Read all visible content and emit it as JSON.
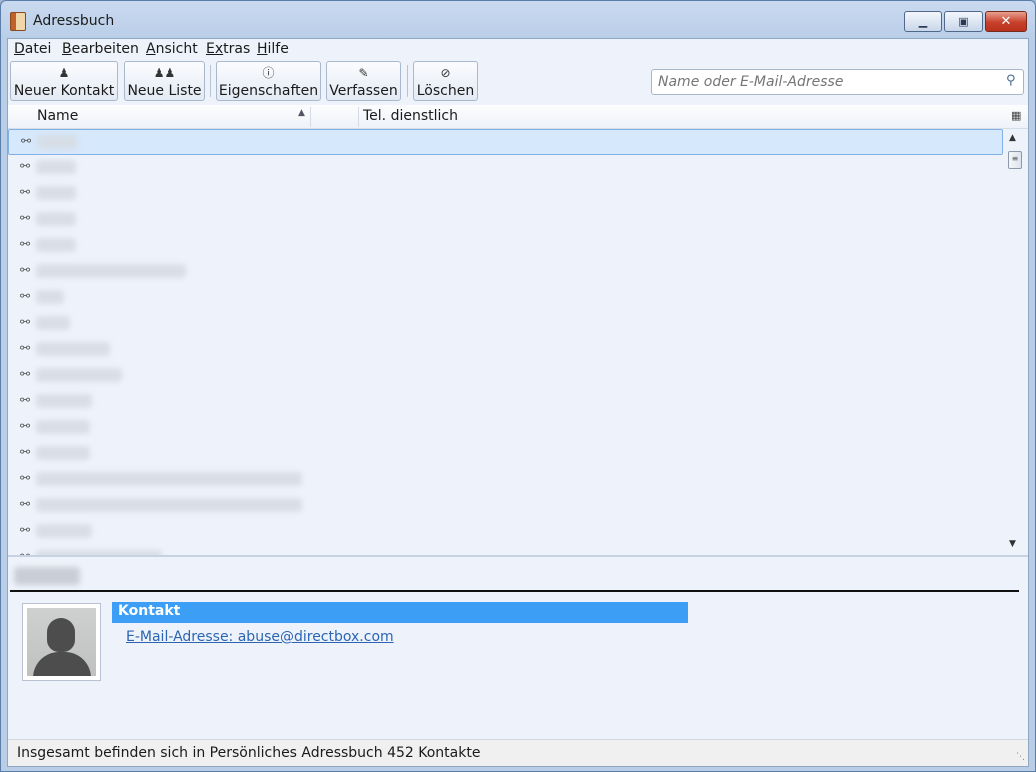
{
  "window": {
    "title": "Adressbuch",
    "minimize": "▁",
    "maximize": "▣",
    "close": "✕"
  },
  "menu": [
    {
      "label": "atei",
      "accel": "D"
    },
    {
      "label": "earbeiten",
      "accel": "B"
    },
    {
      "label": "nsicht",
      "accel": "A"
    },
    {
      "label": "tras",
      "accel": "Ex"
    },
    {
      "label": "ilfe",
      "accel": "H"
    }
  ],
  "toolbar": {
    "new_contact": "Neuer Kontakt",
    "new_list": "Neue Liste",
    "properties": "Eigenschaften",
    "compose": "Verfassen",
    "delete": "Löschen"
  },
  "search": {
    "placeholder": "Name oder E-Mail-Adresse"
  },
  "columns": {
    "name": "Name",
    "tel": "Tel. dienstlich"
  },
  "card": {
    "section": "Kontakt",
    "email": "E-Mail-Adresse: abuse@directbox.com"
  },
  "status": {
    "text": "Insgesamt befinden sich in Persönliches Adressbuch 452 Kontakte"
  },
  "colors": {
    "selection": "#d6e8fb",
    "section_head": "#3d9ef5",
    "link": "#2b65b2"
  },
  "icons": {
    "person": "person-icon",
    "search": "search-icon"
  }
}
